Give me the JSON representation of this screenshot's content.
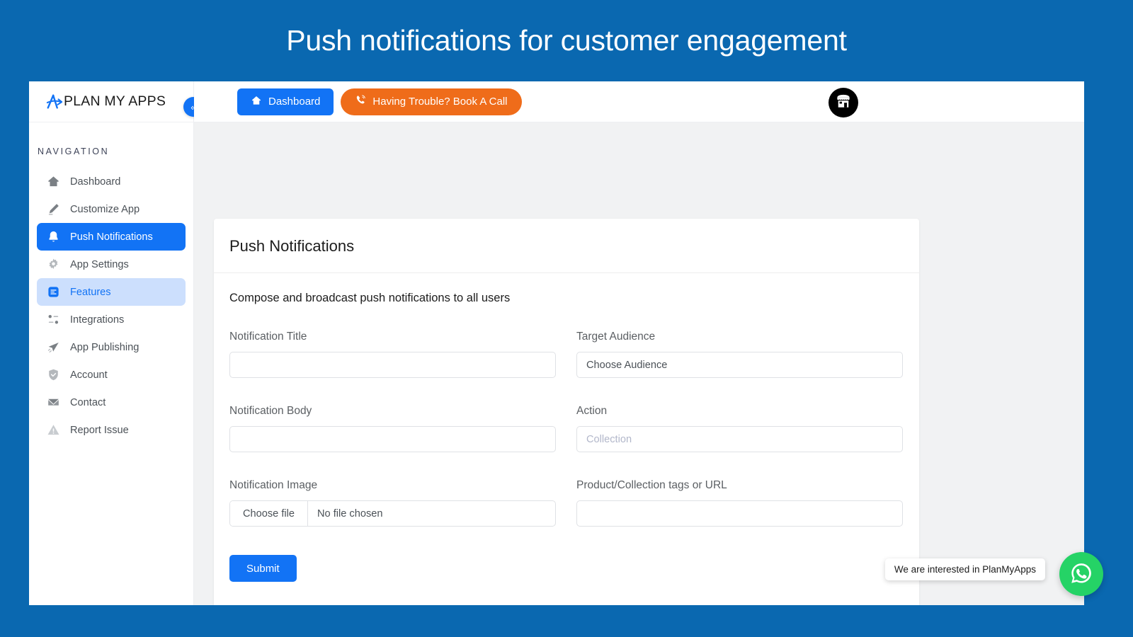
{
  "banner": {
    "title": "Push notifications for customer engagement"
  },
  "brand": {
    "name": "PLAN MY APPS",
    "logo_icon": "plan-my-apps-logo-icon",
    "collapse_label": "«"
  },
  "sidebar": {
    "heading": "NAVIGATION",
    "items": [
      {
        "label": "Dashboard",
        "icon": "home-icon",
        "state": "default"
      },
      {
        "label": "Customize App",
        "icon": "pencil-icon",
        "state": "default"
      },
      {
        "label": "Push Notifications",
        "icon": "bell-icon",
        "state": "active"
      },
      {
        "label": "App Settings",
        "icon": "gear-icon",
        "state": "default"
      },
      {
        "label": "Features",
        "icon": "list-icon",
        "state": "soft-active"
      },
      {
        "label": "Integrations",
        "icon": "sliders-icon",
        "state": "default"
      },
      {
        "label": "App Publishing",
        "icon": "paper-plane-icon",
        "state": "default"
      },
      {
        "label": "Account",
        "icon": "shield-check-icon",
        "state": "default"
      },
      {
        "label": "Contact",
        "icon": "envelope-icon",
        "state": "default"
      },
      {
        "label": "Report Issue",
        "icon": "warning-triangle-icon",
        "state": "default"
      }
    ]
  },
  "topbar": {
    "dashboard_button": "Dashboard",
    "dashboard_icon": "home-icon",
    "call_button": "Having Trouble? Book A Call",
    "call_icon": "phone-icon",
    "shop_icon": "storefront-icon"
  },
  "card": {
    "title": "Push Notifications",
    "subtitle": "Compose and broadcast push notifications to all users",
    "fields": {
      "notification_title": {
        "label": "Notification Title",
        "value": "",
        "placeholder": ""
      },
      "target_audience": {
        "label": "Target Audience",
        "value": "Choose Audience"
      },
      "notification_body": {
        "label": "Notification Body",
        "value": "",
        "placeholder": ""
      },
      "action": {
        "label": "Action",
        "value": "",
        "placeholder": "Collection"
      },
      "notification_image": {
        "label": "Notification Image",
        "button": "Choose file",
        "status": "No file chosen"
      },
      "product_tags": {
        "label": "Product/Collection tags or URL",
        "value": "",
        "placeholder": ""
      }
    },
    "submit_label": "Submit"
  },
  "whatsapp": {
    "tooltip": "We are interested in PlanMyApps",
    "icon": "whatsapp-icon"
  },
  "colors": {
    "page_background": "#0a68b0",
    "primary_blue": "#1273f5",
    "accent_orange": "#ef6c1a",
    "soft_blue": "#ccdffd",
    "whatsapp_green": "#25d366",
    "content_background": "#f1f2f3"
  }
}
